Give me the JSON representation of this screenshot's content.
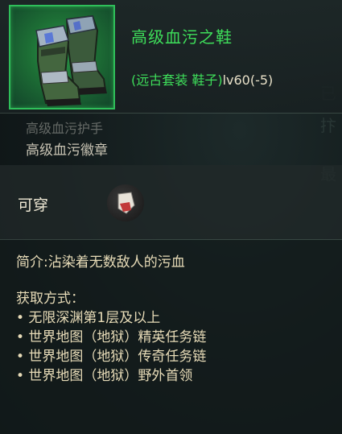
{
  "item": {
    "name": "高级血污之鞋",
    "set_info": "(远古套装 鞋子)",
    "level_info": "lv60(-5)",
    "icon": "boots-icon",
    "frame_color": "#2fbf5a",
    "name_color": "#3ede5a"
  },
  "faded_line": "高级血污护手",
  "set_piece": "高级血污徽章",
  "wearable_label": "可穿",
  "wearable_icon": "wearable-status-icon",
  "description": "简介:沾染着无数敌人的污血",
  "obtain": {
    "title": "获取方式：",
    "sources": [
      "• 无限深渊第1层及以上",
      "• 世界地图（地狱）精英任务链",
      "• 世界地图（地狱）传奇任务链",
      "• 世界地图（地狱）野外首领"
    ]
  }
}
